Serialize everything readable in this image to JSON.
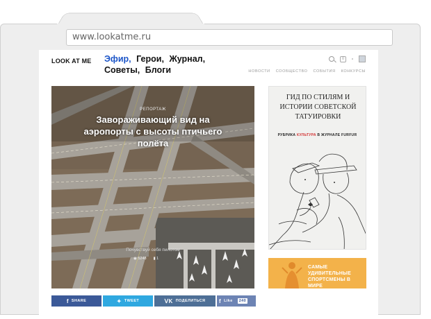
{
  "browser": {
    "url": "www.lookatme.ru"
  },
  "header": {
    "logo": "LOOK AT ME",
    "nav": [
      "Эфир,",
      "Герои,",
      "Журнал,",
      "Советы,",
      "Блоги"
    ],
    "subnav": [
      "НОВОСТИ",
      "СООБЩЕСТВО",
      "СОБЫТИЯ",
      "КОНКУРСЫ"
    ],
    "notifications_count": "0"
  },
  "hero": {
    "rubric": "РЕПОРТАЖ",
    "title": "Завораживающий вид на аэропорты с высоты птичьего полёта",
    "subtitle": "Почувствуй себя пилотом",
    "views": "5248",
    "comments": "1"
  },
  "share": {
    "facebook": "SHARE",
    "twitter": "TWEET",
    "vk": "ПОДЕЛИТЬСЯ",
    "like": "Like",
    "like_count": "240"
  },
  "banner_tattoo": {
    "title": "ГИД ПО СТИЛЯМ И ИСТОРИИ СОВЕТСКОЙ ТАТУИРОВКИ",
    "rubric_prefix": "РУБРИКА ",
    "rubric_highlight": "КУЛЬТУРА",
    "rubric_suffix": " В ЖУРНАЛЕ FURFUR"
  },
  "banner_sport": {
    "line1": "САМЫЕ УДИВИТЕЛЬНЫЕ",
    "line2": "СПОРТСМЕНЫ В МИРЕ"
  },
  "colors": {
    "nav_active": "#1a54c8",
    "facebook": "#3b5998",
    "twitter": "#2fa8e0",
    "vk": "#4e6f96",
    "banner_sport": "#f3b24a",
    "rubric_highlight": "#d23030"
  }
}
